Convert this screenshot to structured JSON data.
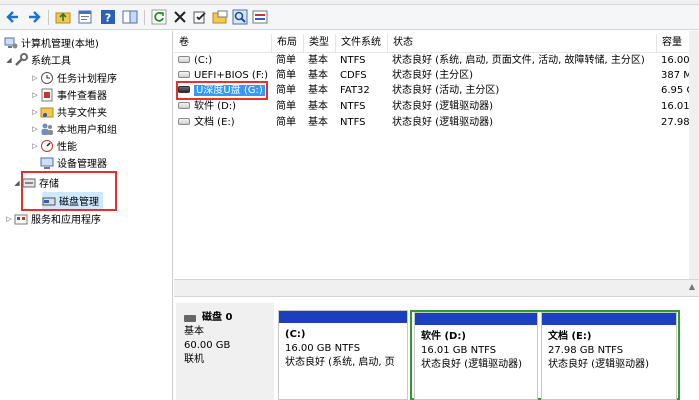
{
  "toolbar": {
    "icons": [
      "back-arrow-icon",
      "forward-arrow-icon",
      "up-folder-icon",
      "properties-icon",
      "help-icon",
      "show-hide-icon",
      "refresh-icon",
      "delete-icon",
      "check-icon",
      "search-icon",
      "export-icon"
    ]
  },
  "tree": {
    "root": "计算机管理(本地)",
    "system_tools": "系统工具",
    "task_scheduler": "任务计划程序",
    "event_viewer": "事件查看器",
    "shared_folders": "共享文件夹",
    "local_users": "本地用户和组",
    "performance": "性能",
    "device_manager": "设备管理器",
    "storage": "存储",
    "disk_management": "磁盘管理",
    "services_apps": "服务和应用程序"
  },
  "volume_list": {
    "headers": [
      "卷",
      "布局",
      "类型",
      "文件系统",
      "状态",
      "容量"
    ],
    "rows": [
      {
        "name": "(C:)",
        "layout": "简单",
        "type": "基本",
        "fs": "NTFS",
        "status": "状态良好 (系统, 启动, 页面文件, 活动, 故障转储, 主分区)",
        "capacity": "16.00"
      },
      {
        "name": "UEFI+BIOS (F:)",
        "layout": "简单",
        "type": "基本",
        "fs": "CDFS",
        "status": "状态良好 (主分区)",
        "capacity": "387 M"
      },
      {
        "name": "U深度U盘 (G:)",
        "layout": "简单",
        "type": "基本",
        "fs": "FAT32",
        "status": "状态良好 (活动, 主分区)",
        "capacity": "6.95 G"
      },
      {
        "name": "软件 (D:)",
        "layout": "简单",
        "type": "基本",
        "fs": "NTFS",
        "status": "状态良好 (逻辑驱动器)",
        "capacity": "16.01"
      },
      {
        "name": "文档 (E:)",
        "layout": "简单",
        "type": "基本",
        "fs": "NTFS",
        "status": "状态良好 (逻辑驱动器)",
        "capacity": "27.98"
      }
    ]
  },
  "disk": {
    "name": "磁盘 0",
    "kind": "基本",
    "size": "60.00 GB",
    "state": "联机",
    "partitions": [
      {
        "title": "(C:)",
        "size": "16.00 GB NTFS",
        "status": "状态良好 (系统, 启动, 页"
      },
      {
        "title": "软件  (D:)",
        "size": "16.01 GB NTFS",
        "status": "状态良好 (逻辑驱动器)"
      },
      {
        "title": "文档  (E:)",
        "size": "27.98 GB NTFS",
        "status": "状态良好 (逻辑驱动器)"
      }
    ]
  },
  "colors": {
    "highlight_red": "#e0332c",
    "selection_blue": "#3399ff",
    "partition_bar": "#1c3fbd",
    "logical_green": "#2f9b2f"
  }
}
